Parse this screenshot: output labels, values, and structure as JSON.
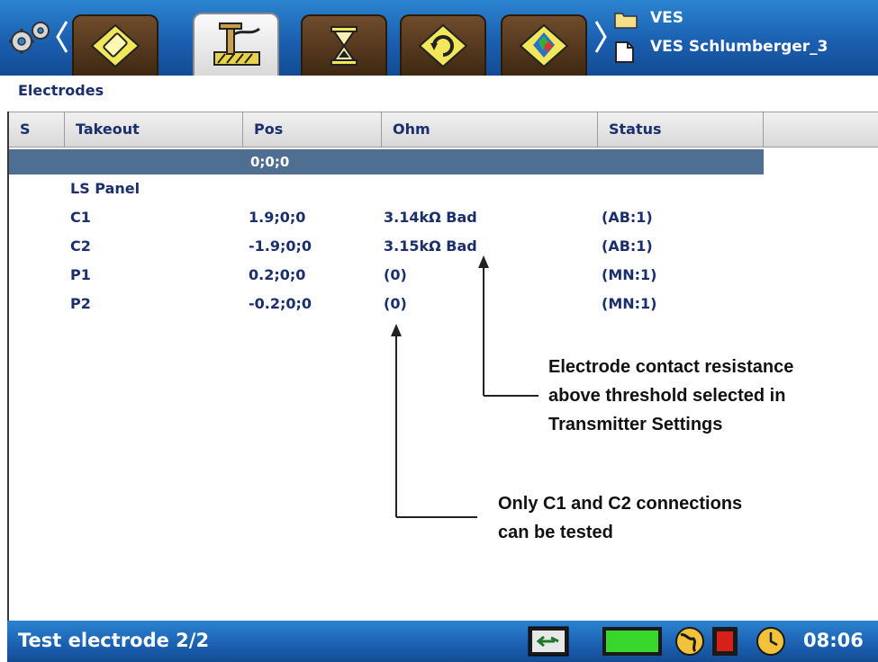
{
  "header": {
    "project": "VES",
    "file": "VES Schlumberger_3",
    "tabs": [
      {
        "icon": "instrument-icon",
        "active": false
      },
      {
        "icon": "electrode-test-icon",
        "active": true
      },
      {
        "icon": "hourglass-icon",
        "active": false
      },
      {
        "icon": "cycle-icon",
        "active": false
      },
      {
        "icon": "map-icon",
        "active": false
      }
    ]
  },
  "section_title": "Electrodes",
  "table": {
    "columns": [
      "S",
      "Takeout",
      "Pos",
      "Ohm",
      "Status"
    ],
    "selected_row_pos": "0;0;0",
    "group": "LS Panel",
    "rows": [
      {
        "takeout": "C1",
        "pos": "1.9;0;0",
        "ohm": "3.14kΩ Bad",
        "status": "(AB:1)"
      },
      {
        "takeout": "C2",
        "pos": "-1.9;0;0",
        "ohm": "3.15kΩ Bad",
        "status": "(AB:1)"
      },
      {
        "takeout": "P1",
        "pos": "0.2;0;0",
        "ohm": "(0)",
        "status": "(MN:1)"
      },
      {
        "takeout": "P2",
        "pos": "-0.2;0;0",
        "ohm": "(0)",
        "status": "(MN:1)"
      }
    ]
  },
  "annotations": {
    "resistance": [
      "Electrode contact resistance",
      "above threshold selected in",
      "Transmitter Settings"
    ],
    "connections": [
      "Only C1 and C2 connections",
      "can be tested"
    ]
  },
  "status_bar": {
    "text": "Test electrode 2/2",
    "time": "08:06"
  },
  "colors": {
    "bar_blue": "#1b5fb0",
    "selected_row": "#4f6f92",
    "text_navy": "#1a2f6b"
  }
}
